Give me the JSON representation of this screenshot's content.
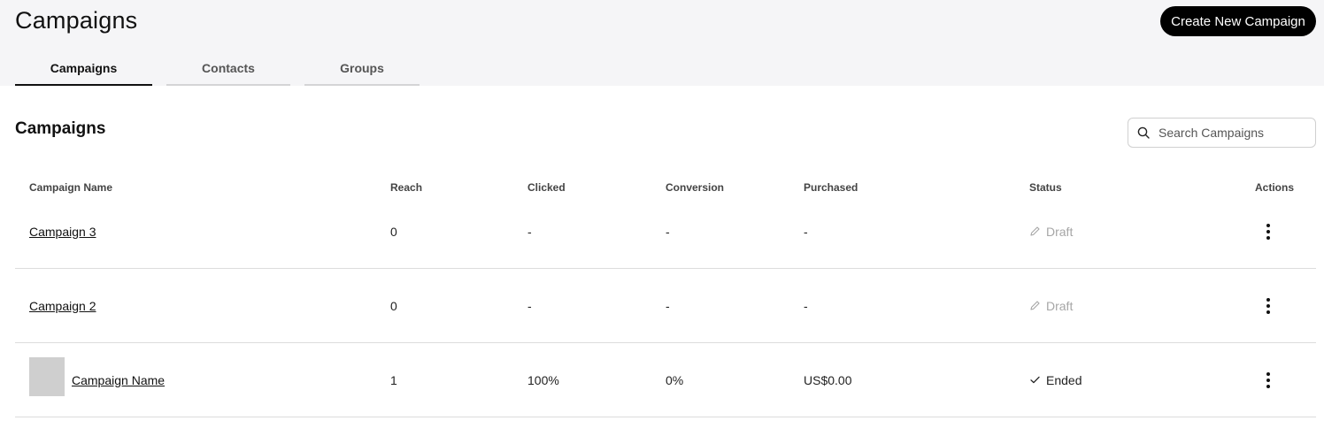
{
  "header": {
    "title": "Campaigns",
    "create_button_label": "Create New Campaign"
  },
  "tabs": [
    {
      "label": "Campaigns",
      "active": true
    },
    {
      "label": "Contacts",
      "active": false
    },
    {
      "label": "Groups",
      "active": false
    }
  ],
  "section": {
    "title": "Campaigns"
  },
  "search": {
    "placeholder": "Search Campaigns",
    "value": "",
    "icon": "search-icon"
  },
  "table": {
    "columns": [
      "Campaign Name",
      "Reach",
      "Clicked",
      "Conversion",
      "Purchased",
      "Status",
      "Actions"
    ],
    "rows": [
      {
        "name": "Campaign 3",
        "reach": "0",
        "clicked": "-",
        "conversion": "-",
        "purchased": "-",
        "status": "Draft",
        "status_icon": "pencil-icon",
        "has_thumbnail": false
      },
      {
        "name": "Campaign 2",
        "reach": "0",
        "clicked": "-",
        "conversion": "-",
        "purchased": "-",
        "status": "Draft",
        "status_icon": "pencil-icon",
        "has_thumbnail": false
      },
      {
        "name": "Campaign Name",
        "reach": "1",
        "clicked": "100%",
        "conversion": "0%",
        "purchased": "US$0.00",
        "status": "Ended",
        "status_icon": "checkmark-icon",
        "has_thumbnail": true
      }
    ]
  },
  "colors": {
    "header_bg": "#f5f5f7",
    "primary_button": "#000000",
    "draft_status": "#a6a6a6"
  }
}
